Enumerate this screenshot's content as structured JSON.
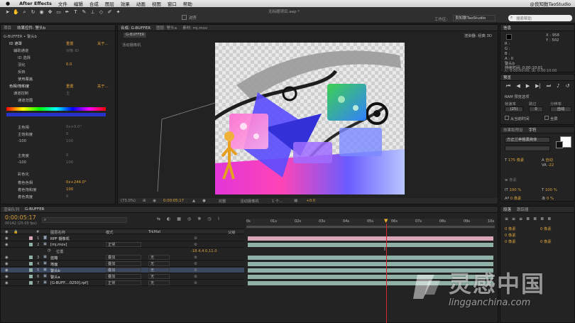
{
  "menubar": {
    "app_name": "After Effects",
    "items": [
      "文件",
      "编辑",
      "合成",
      "图层",
      "效果",
      "动画",
      "视图",
      "窗口",
      "帮助"
    ],
    "user": "@良知数TaoStudio"
  },
  "window_title": "无标题项目.aep *",
  "toolbar": {
    "workspace_label": "工作区:",
    "workspace_value": "良知数TaoStudio",
    "search_placeholder": "搜索帮助",
    "snap_label": "对齐"
  },
  "effect_controls": {
    "tab_label": "效果控件: 警头b",
    "header": "G-BUFFER • 警头b",
    "rows": [
      {
        "text": "ID 遮罩",
        "right": "重置",
        "right2": "关于..."
      },
      {
        "text": "辅助通道",
        "value": "对象 ID"
      },
      {
        "text": "ID 选择"
      },
      {
        "text": "羽化",
        "value": "0.0"
      },
      {
        "text": "反转"
      },
      {
        "text": "使用覆盖"
      },
      {
        "text": "色相/饱和度",
        "right": "重置",
        "right2": "关于..."
      },
      {
        "text": "通道控制",
        "value": "主"
      },
      {
        "text": "通道范围"
      },
      {
        "text": "主色相",
        "value": "0x+0.0°"
      },
      {
        "text": "主饱和度",
        "value": "0"
      },
      {
        "text": "-100",
        "value": "100"
      },
      {
        "text": "主亮度",
        "value": "0"
      },
      {
        "text": "-100",
        "value": "100"
      },
      {
        "text": "彩色化"
      },
      {
        "text": "着色色相",
        "value": "0x+244.0°"
      },
      {
        "text": "着色饱和度",
        "value": "100"
      },
      {
        "text": "着色亮度",
        "value": "0"
      }
    ]
  },
  "viewer": {
    "tabs": [
      "合成: G-BUFFER",
      "图层: 警头a",
      "素材: mj.mov"
    ],
    "active_comp_tab": "G-BUFFER",
    "renderer_label": "渲染器:",
    "renderer_value": "经典 3D",
    "camera_label": "活动摄像机",
    "zoom": "(73.0%)",
    "timecode": "0:00:05:17",
    "resolution": "完整",
    "view": "活动摄像机",
    "views_count": "1 个...",
    "exposure": "+0.0"
  },
  "info": {
    "tab_label": "信息",
    "x": "X : 958",
    "y": "Y : 502",
    "r": "R :",
    "g": "G :",
    "b": "B :",
    "a": "A : 0",
    "layer": "警头b",
    "duration": "持续时间: 0:00:10:01",
    "in": "入: 0:00:00:00, 出: 0:00:10:00"
  },
  "preview": {
    "tab_label": "预览",
    "ram_label": "RAM 预览选项",
    "fps_label": "帧速率",
    "skip_label": "跳过",
    "res_label": "分辨率",
    "fps_value": "(25)",
    "skip_value": "0",
    "res_value": "自动",
    "from_current": "从当前时间",
    "full_screen": "全屏"
  },
  "character": {
    "tabs": [
      "效果和预设",
      "字符"
    ],
    "font": "方正兰亭粗黑简体",
    "size": "175 像素",
    "leading": "自动",
    "tracking": "-22",
    "px_label": "像素",
    "scale_v": "100 %",
    "scale_h": "100 %",
    "baseline": "0 像素",
    "tsume": "0 %"
  },
  "paragraph": {
    "tabs": [
      "段落",
      "跟踪器"
    ],
    "indent1": "0 像素",
    "indent2": "0 像素",
    "indent3": "0 像素",
    "space1": "0 像素",
    "space2": "0 像素"
  },
  "timeline": {
    "tabs": [
      "渲染队列",
      "G-BUFFER"
    ],
    "timecode": "0:00:05:17",
    "frame_info": "00142 (25.00 fps)",
    "search_placeholder": "",
    "headers": {
      "num": "#",
      "name": "图层名称",
      "mode": "模式",
      "trkmat": "TrkMat",
      "parent": "父级"
    },
    "ruler": [
      "0s",
      "01s",
      "02s",
      "03s",
      "04s",
      "05s",
      "06s",
      "07s",
      "08s",
      "09s",
      "10s"
    ],
    "position_prop": "位置",
    "position_value": "-18.4,4.0,11.0",
    "layers": [
      {
        "num": "1",
        "name": "RPF 摄像机",
        "mode": "",
        "trk": "",
        "color": "#d8a6b6"
      },
      {
        "num": "2",
        "name": "[mj.mov]",
        "mode": "正常",
        "trk": "",
        "color": "#8fb1a8"
      },
      {
        "num": "3",
        "name": "蓝箱",
        "mode": "叠加",
        "trk": "无",
        "color": "#8fb1a8"
      },
      {
        "num": "4",
        "name": "地面",
        "mode": "叠加",
        "trk": "无",
        "color": "#8fb1a8"
      },
      {
        "num": "5",
        "name": "警头b",
        "mode": "叠加",
        "trk": "无",
        "color": "#8fb1a8"
      },
      {
        "num": "6",
        "name": "警头a",
        "mode": "叠加",
        "trk": "无",
        "color": "#8fb1a8"
      },
      {
        "num": "7",
        "name": "[G-BUFF....0250].rpf]",
        "mode": "正常",
        "trk": "无",
        "color": "#8fb1a8"
      }
    ]
  },
  "watermark": {
    "cn": "灵感中国",
    "en": "lingganchina.com"
  }
}
